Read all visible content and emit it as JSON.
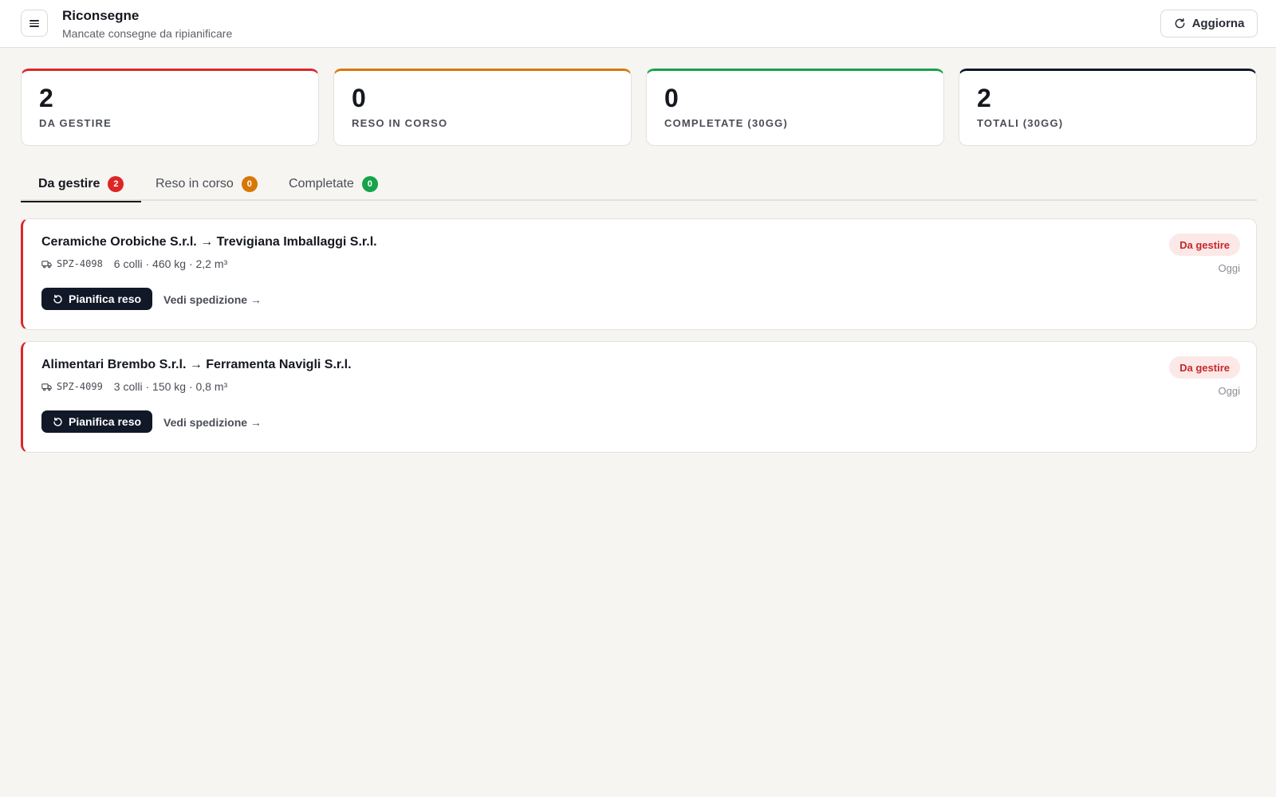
{
  "header": {
    "title": "Riconsegne",
    "subtitle": "Mancate consegne da ripianificare",
    "refresh_label": "Aggiorna"
  },
  "stats": [
    {
      "value": "2",
      "label": "DA GESTIRE",
      "color": "#dc2626"
    },
    {
      "value": "0",
      "label": "RESO IN CORSO",
      "color": "#d97706"
    },
    {
      "value": "0",
      "label": "COMPLETATE (30GG)",
      "color": "#16a34a"
    },
    {
      "value": "2",
      "label": "TOTALI (30GG)",
      "color": "#111827"
    }
  ],
  "tabs": [
    {
      "label": "Da gestire",
      "count": "2",
      "color": "#dc2626",
      "active": true
    },
    {
      "label": "Reso in corso",
      "count": "0",
      "color": "#d97706",
      "active": false
    },
    {
      "label": "Completate",
      "count": "0",
      "color": "#16a34a",
      "active": false
    }
  ],
  "items": [
    {
      "route": "Ceramiche Orobiche S.r.l. → Trevigiana Imballaggi S.r.l.",
      "code": "SPZ-4098",
      "details": "6 colli · 460 kg · 2,2 m³",
      "status": "Da gestire",
      "date": "Oggi",
      "plan_label": "Pianifica reso",
      "view_label": "Vedi spedizione →"
    },
    {
      "route": "Alimentari Brembo S.r.l. → Ferramenta Navigli S.r.l.",
      "code": "SPZ-4099",
      "details": "3 colli · 150 kg · 0,8 m³",
      "status": "Da gestire",
      "date": "Oggi",
      "plan_label": "Pianifica reso",
      "view_label": "Vedi spedizione →"
    }
  ],
  "icons": {
    "menu": "menu-icon",
    "refresh": "refresh-icon",
    "truck": "truck-icon",
    "undo": "undo-icon"
  }
}
